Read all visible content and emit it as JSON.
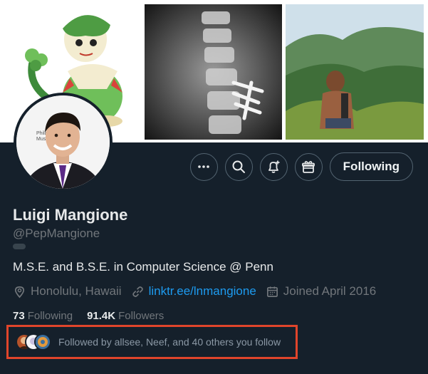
{
  "banner": {
    "images": [
      {
        "label": "pokemon-breloom-art"
      },
      {
        "label": "spine-xray-with-screws"
      },
      {
        "label": "hiking-ridge-photo"
      }
    ]
  },
  "profile": {
    "name": "Luigi Mangione",
    "handle": "@PepMangione",
    "bio": "M.S.E. and B.S.E. in Computer Science @ Penn",
    "location": "Honolulu, Hawaii",
    "website": "linktr.ee/lnmangione",
    "joined": "Joined April 2016",
    "following_count": "73",
    "following_label": "Following",
    "followers_count": "91.4K",
    "followers_label": "Followers",
    "followed_by_text": "Followed by allsee, Neef, and 40 others you follow",
    "avatar_caption": "Philad\nMuse"
  },
  "actions": {
    "more_icon": "more-icon",
    "search_icon": "search-icon",
    "notify_icon": "notification-bell-plus-icon",
    "subscribe_icon": "gift-icon",
    "follow_label": "Following"
  },
  "colors": {
    "background": "#15202b",
    "link": "#1d9bf0",
    "highlight_box": "#e0452b"
  }
}
